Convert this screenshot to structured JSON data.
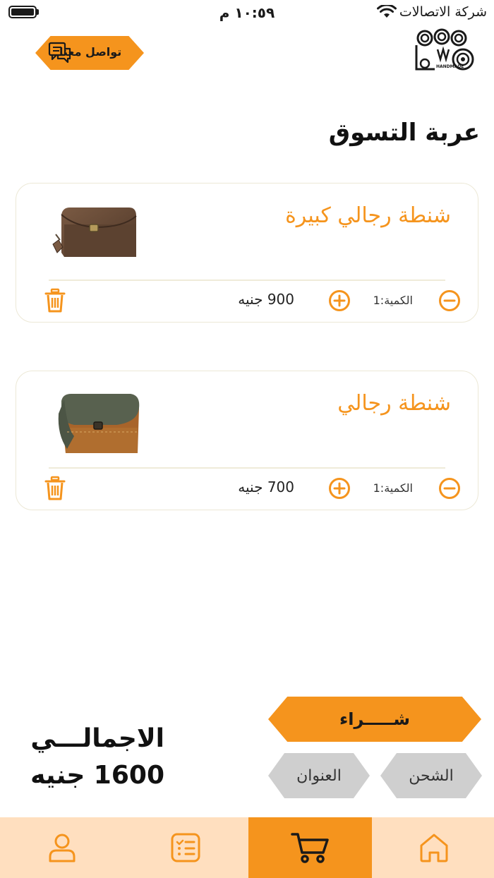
{
  "status_bar": {
    "time": "١٠:٥٩ م",
    "carrier": "شركة الاتصالات",
    "icons": [
      "battery-icon",
      "wifi-icon"
    ]
  },
  "header": {
    "contact_label": "تواصل معنا",
    "contact_icon": "chat-icon",
    "logo_text": "HANDMADE"
  },
  "page_title": "عربة التسوق",
  "cart_items": [
    {
      "name": "شنطة رجالي كبيرة",
      "quantity_label": "الكمية:",
      "quantity": "1",
      "price": "900 جنيه",
      "image": "brown-leather-wallet"
    },
    {
      "name": "شنطة رجالي",
      "quantity_label": "الكمية:",
      "quantity": "1",
      "price": "700 جنيه",
      "image": "green-brown-leather-wallet"
    }
  ],
  "actions": {
    "buy_label": "شـــــراء",
    "shipping_label": "الشحن",
    "address_label": "العنوان"
  },
  "total": {
    "label": "الاجمالـــي",
    "value": "1600 جنيه"
  },
  "bottom_nav": {
    "tabs": [
      "home-icon",
      "cart-icon",
      "orders-icon",
      "profile-icon"
    ],
    "active": "cart-icon"
  },
  "colors": {
    "accent": "#f5941d",
    "nav_background": "#ffdfbf",
    "pill_gray": "#cfcfcf",
    "card_border": "#ece8d6"
  }
}
